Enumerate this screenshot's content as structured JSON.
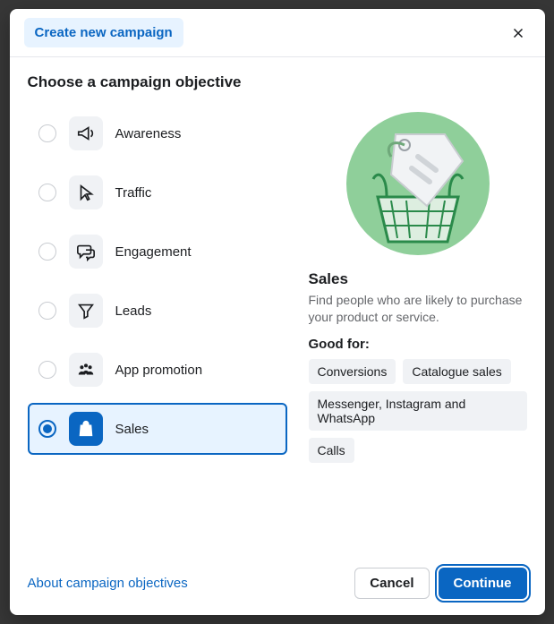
{
  "header": {
    "chip_label": "Create new campaign"
  },
  "section_title": "Choose a campaign objective",
  "objectives": [
    {
      "label": "Awareness"
    },
    {
      "label": "Traffic"
    },
    {
      "label": "Engagement"
    },
    {
      "label": "Leads"
    },
    {
      "label": "App promotion"
    },
    {
      "label": "Sales"
    }
  ],
  "detail": {
    "title": "Sales",
    "description": "Find people who are likely to purchase your product or service.",
    "good_for_label": "Good for:",
    "tags": [
      "Conversions",
      "Catalogue sales",
      "Messenger, Instagram and WhatsApp",
      "Calls"
    ]
  },
  "footer": {
    "about_link": "About campaign objectives",
    "cancel": "Cancel",
    "continue": "Continue"
  }
}
